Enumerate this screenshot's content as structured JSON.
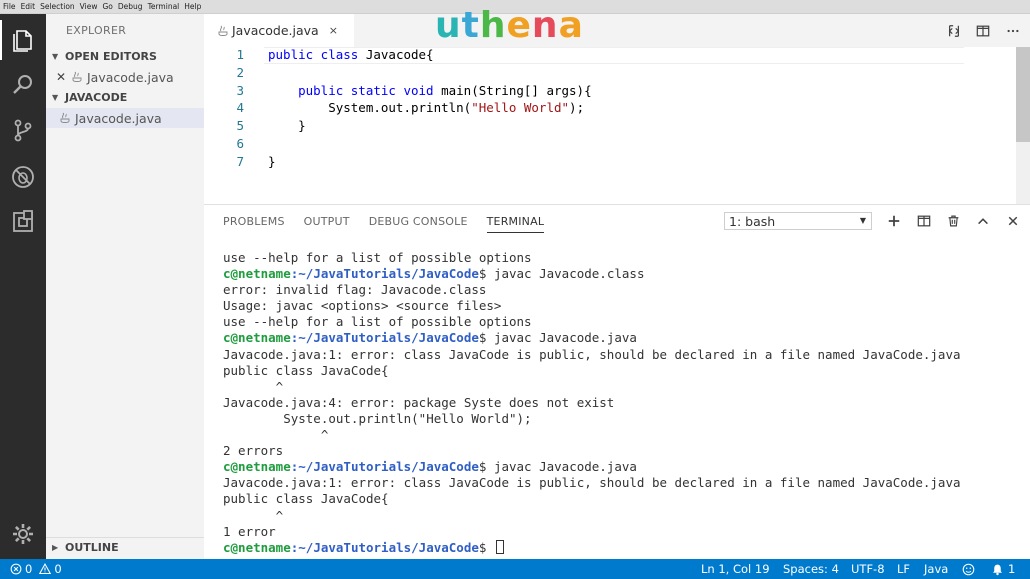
{
  "menu": [
    "File",
    "Edit",
    "Selection",
    "View",
    "Go",
    "Debug",
    "Terminal",
    "Help"
  ],
  "logo": {
    "text": "uthena",
    "letters": [
      "u",
      "t",
      "h",
      "e",
      "n",
      "a"
    ],
    "colors": [
      "#2bb4b4",
      "#3aa7d4",
      "#4cb848",
      "#f0a022",
      "#e64b5a",
      "#f0a022"
    ]
  },
  "activity": {
    "icons": [
      "files-icon",
      "search-icon",
      "source-control-icon",
      "debug-icon",
      "extensions-icon"
    ],
    "settings_icon": "gear-icon"
  },
  "sidebar": {
    "title": "EXPLORER",
    "open_editors": {
      "label": "OPEN EDITORS",
      "items": [
        {
          "name": "Javacode.java"
        }
      ]
    },
    "project": {
      "label": "JAVACODE",
      "items": [
        {
          "name": "Javacode.java"
        }
      ]
    },
    "outline": {
      "label": "OUTLINE"
    }
  },
  "editor": {
    "tab": {
      "label": "Javacode.java",
      "close": "×"
    },
    "line_numbers": [
      "1",
      "2",
      "3",
      "4",
      "5",
      "6",
      "7"
    ],
    "code": [
      [
        {
          "t": "public class ",
          "k": "kw"
        },
        {
          "t": "Javacode{",
          "k": ""
        }
      ],
      [],
      [
        {
          "t": "    public static void ",
          "k": "kw"
        },
        {
          "t": "main(String[] args){",
          "k": ""
        }
      ],
      [
        {
          "t": "        System.out.println(",
          "k": ""
        },
        {
          "t": "\"Hello World\"",
          "k": "str"
        },
        {
          "t": ");",
          "k": ""
        }
      ],
      [
        {
          "t": "    }",
          "k": ""
        }
      ],
      [],
      [
        {
          "t": "}",
          "k": ""
        }
      ]
    ]
  },
  "panel": {
    "tabs": [
      "PROBLEMS",
      "OUTPUT",
      "DEBUG CONSOLE",
      "TERMINAL"
    ],
    "active_tab": "TERMINAL",
    "terminal_select": "1: bash",
    "prompt": {
      "user": "c@netname",
      "sep": ":",
      "path": "~/JavaTutorials/JavaCode",
      "dollar": "$ "
    },
    "lines": [
      {
        "text": "use --help for a list of possible options"
      },
      {
        "prompt": true,
        "text": "javac Javacode.class"
      },
      {
        "text": "error: invalid flag: Javacode.class"
      },
      {
        "text": "Usage: javac <options> <source files>"
      },
      {
        "text": "use --help for a list of possible options"
      },
      {
        "prompt": true,
        "text": "javac Javacode.java"
      },
      {
        "text": "Javacode.java:1: error: class JavaCode is public, should be declared in a file named JavaCode.java"
      },
      {
        "text": "public class JavaCode{"
      },
      {
        "text": "       ^"
      },
      {
        "text": "Javacode.java:4: error: package Syste does not exist"
      },
      {
        "text": "        Syste.out.println(\"Hello World\");"
      },
      {
        "text": "             ^"
      },
      {
        "text": "2 errors"
      },
      {
        "prompt": true,
        "text": "javac Javacode.java"
      },
      {
        "text": "Javacode.java:1: error: class JavaCode is public, should be declared in a file named JavaCode.java"
      },
      {
        "text": "public class JavaCode{"
      },
      {
        "text": "       ^"
      },
      {
        "text": "1 error"
      },
      {
        "prompt": true,
        "text": "",
        "cursor": true
      }
    ]
  },
  "status": {
    "errors": "0",
    "warnings": "0",
    "position": "Ln 1, Col 19",
    "spaces": "Spaces: 4",
    "encoding": "UTF-8",
    "eol": "LF",
    "language": "Java",
    "notifications": "1"
  },
  "colors": {
    "accent": "#007acc",
    "activity_bar": "#2c2c2c",
    "sidebar": "#f3f3f3"
  }
}
